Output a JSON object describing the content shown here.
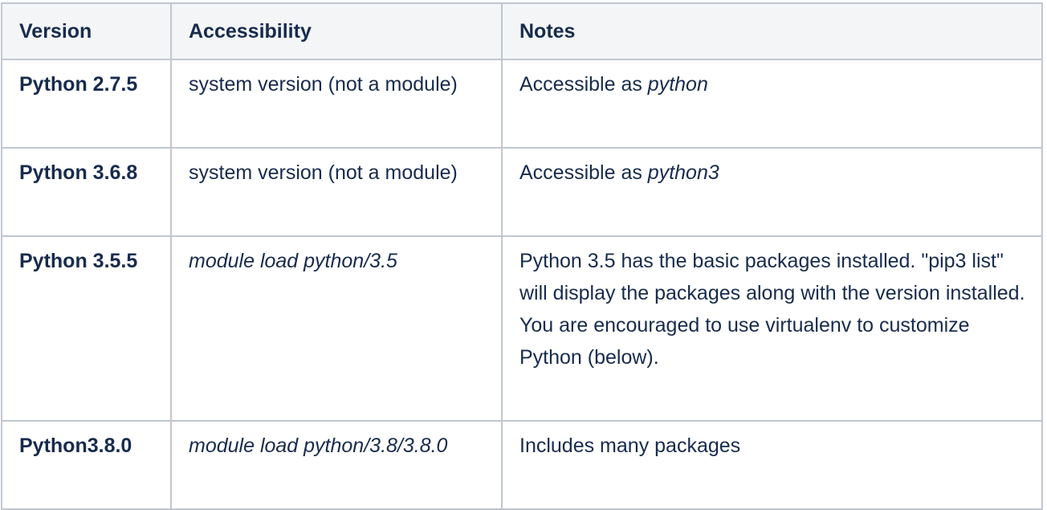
{
  "table": {
    "headers": [
      "Version",
      "Accessibility",
      "Notes"
    ],
    "rows": [
      {
        "version": "Python 2.7.5",
        "access": "system version (not a module)",
        "notes_prefix": "Accessible as ",
        "notes_em": "python"
      },
      {
        "version": "Python 3.6.8",
        "access": "system version (not a module)",
        "notes_prefix": "Accessible as ",
        "notes_em": "python3"
      },
      {
        "version": "Python 3.5.5",
        "access": "module load python/3.5",
        "notes_lines": [
          "Python 3.5 has the basic packages installed. \"pip3 list\"  will display the packages along with the version installed.",
          "You are encouraged to use virtualenv to customize Python (below)."
        ]
      },
      {
        "version": "Python3.8.0",
        "access": "module load python/3.8/3.8.0",
        "notes": "Includes many packages"
      }
    ]
  }
}
